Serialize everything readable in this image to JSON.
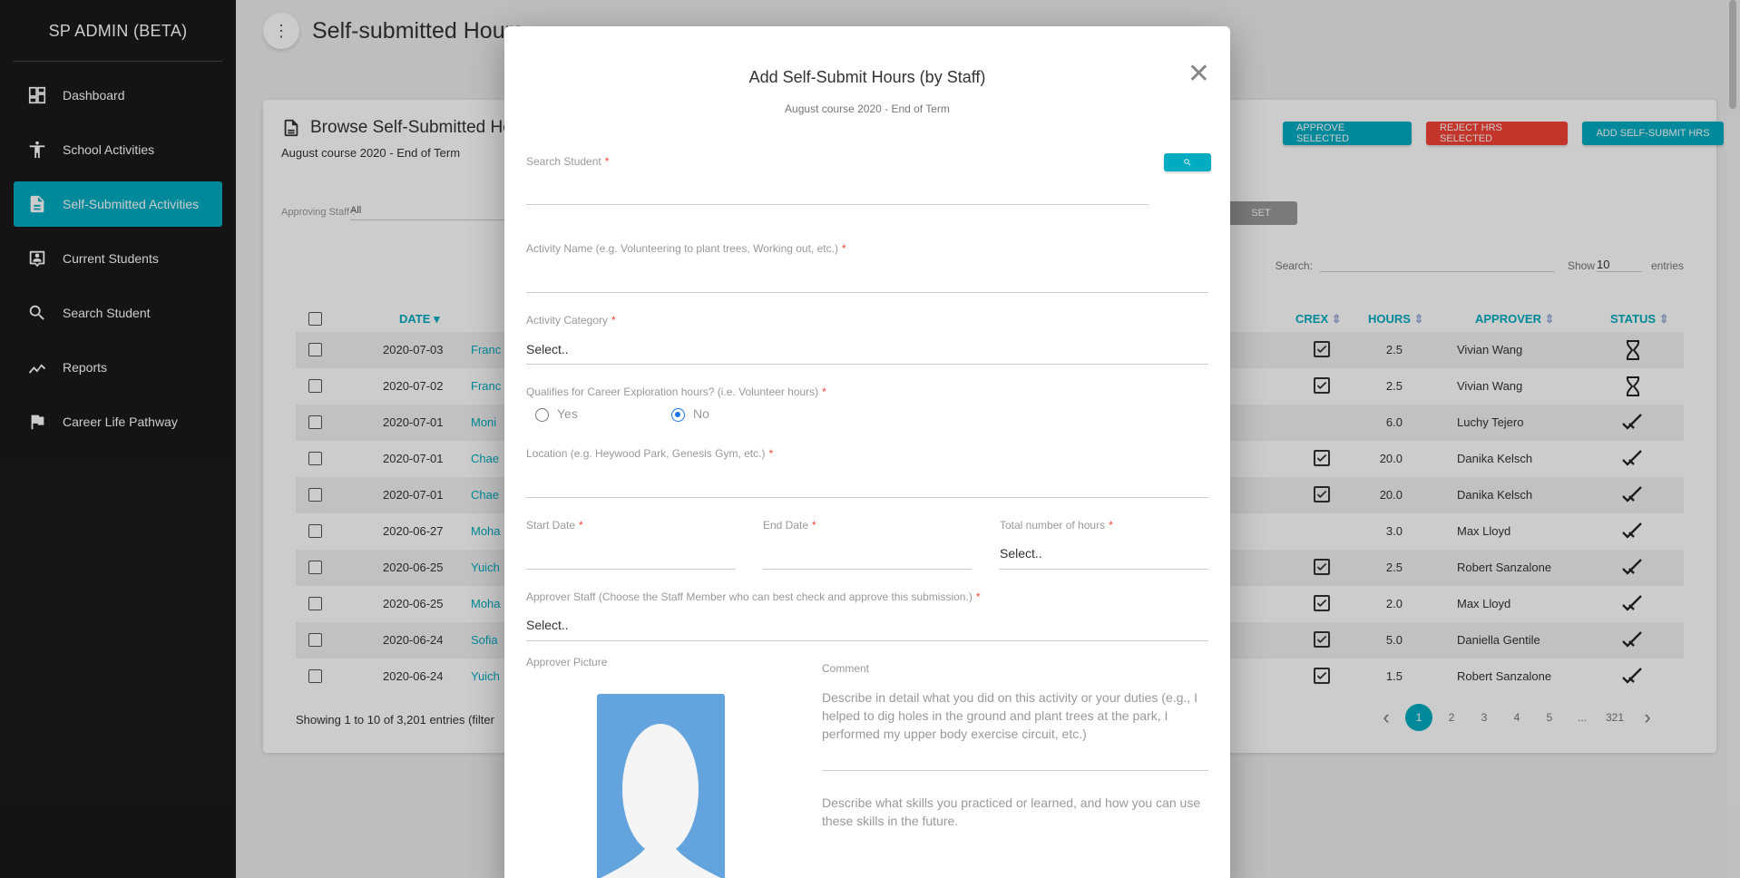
{
  "sidebar": {
    "brand": "SP ADMIN (BETA)",
    "items": [
      {
        "label": "Dashboard",
        "icon": "dashboard-icon"
      },
      {
        "label": "School Activities",
        "icon": "accessibility-icon"
      },
      {
        "label": "Self-Submitted Activities",
        "icon": "document-icon",
        "active": true
      },
      {
        "label": "Current Students",
        "icon": "badge-icon"
      },
      {
        "label": "Search Student",
        "icon": "search-icon"
      },
      {
        "label": "Reports",
        "icon": "trending-icon"
      },
      {
        "label": "Career Life Pathway",
        "icon": "flag-icon"
      }
    ]
  },
  "header": {
    "title": "Self-submitted Hours"
  },
  "card": {
    "title": "Browse Self-Submitted Hours",
    "subtitle": "August course 2020 - End of Term",
    "buttons": {
      "approve": "APPROVE SELECTED",
      "reject": "REJECT HRS SELECTED",
      "add": "ADD SELF-SUBMIT HRS"
    },
    "filter_label": "Approving Staff :",
    "filter_value": "All",
    "reset_label": "SET",
    "search_label": "Search:",
    "show_label": "Show",
    "show_value": "10",
    "entries_label": "entries"
  },
  "table": {
    "headers": {
      "date": "DATE",
      "crex": "CREX",
      "hours": "HOURS",
      "approver": "APPROVER",
      "status": "STATUS"
    },
    "rows": [
      {
        "date": "2020-07-03",
        "name": "Franc",
        "crex": true,
        "hours": "2.5",
        "approver": "Vivian Wang",
        "status": "pending"
      },
      {
        "date": "2020-07-02",
        "name": "Franc",
        "crex": true,
        "hours": "2.5",
        "approver": "Vivian Wang",
        "status": "pending"
      },
      {
        "date": "2020-07-01",
        "name": "Moni",
        "crex": false,
        "hours": "6.0",
        "approver": "Luchy Tejero",
        "status": "approved"
      },
      {
        "date": "2020-07-01",
        "name": "Chae",
        "crex": true,
        "hours": "20.0",
        "approver": "Danika Kelsch",
        "status": "approved"
      },
      {
        "date": "2020-07-01",
        "name": "Chae",
        "crex": true,
        "hours": "20.0",
        "approver": "Danika Kelsch",
        "status": "approved"
      },
      {
        "date": "2020-06-27",
        "name": "Moha",
        "crex": false,
        "hours": "3.0",
        "approver": "Max Lloyd",
        "status": "approved"
      },
      {
        "date": "2020-06-25",
        "name": "Yuich",
        "crex": true,
        "hours": "2.5",
        "approver": "Robert Sanzalone",
        "status": "approved"
      },
      {
        "date": "2020-06-25",
        "name": "Moha",
        "crex": true,
        "hours": "2.0",
        "approver": "Max Lloyd",
        "status": "approved"
      },
      {
        "date": "2020-06-24",
        "name": "Sofia",
        "crex": true,
        "hours": "5.0",
        "approver": "Daniella Gentile",
        "status": "approved"
      },
      {
        "date": "2020-06-24",
        "name": "Yuich",
        "crex": true,
        "hours": "1.5",
        "approver": "Robert Sanzalone",
        "status": "approved"
      }
    ],
    "footer_info": "Showing 1 to 10 of 3,201 entries (filter",
    "pagination": [
      "1",
      "2",
      "3",
      "4",
      "5",
      "...",
      "321"
    ],
    "current_page": "1"
  },
  "modal": {
    "title": "Add Self-Submit Hours (by Staff)",
    "subtitle": "August course 2020 - End of Term",
    "fields": {
      "search_student": "Search Student",
      "activity_name": "Activity Name (e.g. Volunteering to plant trees, Working out, etc.)",
      "activity_category": "Activity Category",
      "activity_category_value": "Select..",
      "qualifies": "Qualifies for Career Exploration hours? (i.e. Volunteer hours)",
      "yes": "Yes",
      "no": "No",
      "qualifies_selected": "No",
      "location": "Location (e.g. Heywood Park, Genesis Gym, etc.)",
      "start_date": "Start Date",
      "end_date": "End Date",
      "total_hours": "Total number of hours",
      "total_hours_value": "Select..",
      "approver_staff": "Approver Staff (Choose the Staff Member who can best check and approve this submission.)",
      "approver_staff_value": "Select..",
      "approver_picture": "Approver Picture",
      "comment": "Comment",
      "comment_placeholder_1": "Describe in detail what you did on this activity or your duties (e.g., I helped to dig holes in the ground and plant trees at the park, I performed my upper body exercise circuit, etc.)",
      "comment_placeholder_2": "Describe what skills you practiced or learned, and how you can use these skills in the future."
    },
    "required_mark": "*"
  }
}
